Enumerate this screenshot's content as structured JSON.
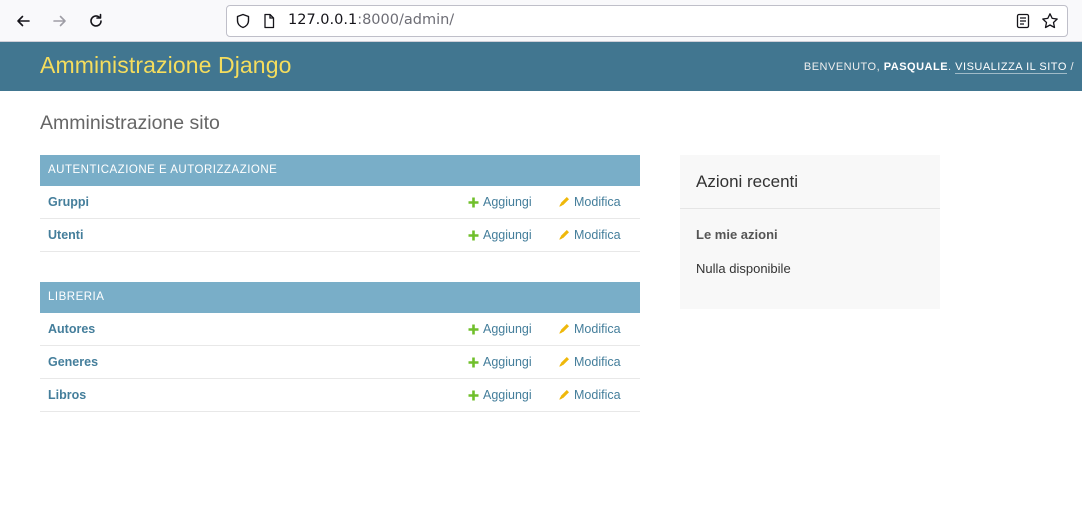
{
  "browser": {
    "url_host": "127.0.0.1",
    "url_rest": ":8000/admin/"
  },
  "header": {
    "branding": "Amministrazione Django",
    "welcome": "BENVENUTO,",
    "username": "PASQUALE",
    "sep": ".",
    "view_site": "VISUALIZZA IL SITO",
    "slash": "/"
  },
  "page_title": "Amministrazione sito",
  "modules": [
    {
      "caption": "AUTENTICAZIONE E AUTORIZZAZIONE",
      "rows": [
        {
          "name": "Gruppi",
          "add": "Aggiungi",
          "change": "Modifica"
        },
        {
          "name": "Utenti",
          "add": "Aggiungi",
          "change": "Modifica"
        }
      ]
    },
    {
      "caption": "LIBRERIA",
      "rows": [
        {
          "name": "Autores",
          "add": "Aggiungi",
          "change": "Modifica"
        },
        {
          "name": "Generes",
          "add": "Aggiungi",
          "change": "Modifica"
        },
        {
          "name": "Libros",
          "add": "Aggiungi",
          "change": "Modifica"
        }
      ]
    }
  ],
  "recent": {
    "title": "Azioni recenti",
    "subtitle": "Le mie azioni",
    "empty": "Nulla disponibile"
  },
  "colors": {
    "header_bg": "#417690",
    "branding": "#f5dd5d",
    "caption_bg": "#79aec8",
    "link": "#447e9b",
    "add_icon": "#70bf2b",
    "change_icon": "#efb80b"
  },
  "icons": {
    "back": "arrow-left-icon",
    "forward": "arrow-right-icon",
    "reload": "reload-icon",
    "shield": "shield-icon",
    "page": "page-icon",
    "reader": "reader-view-icon",
    "bookmark": "star-icon",
    "add": "plus-icon",
    "change": "pencil-icon"
  }
}
